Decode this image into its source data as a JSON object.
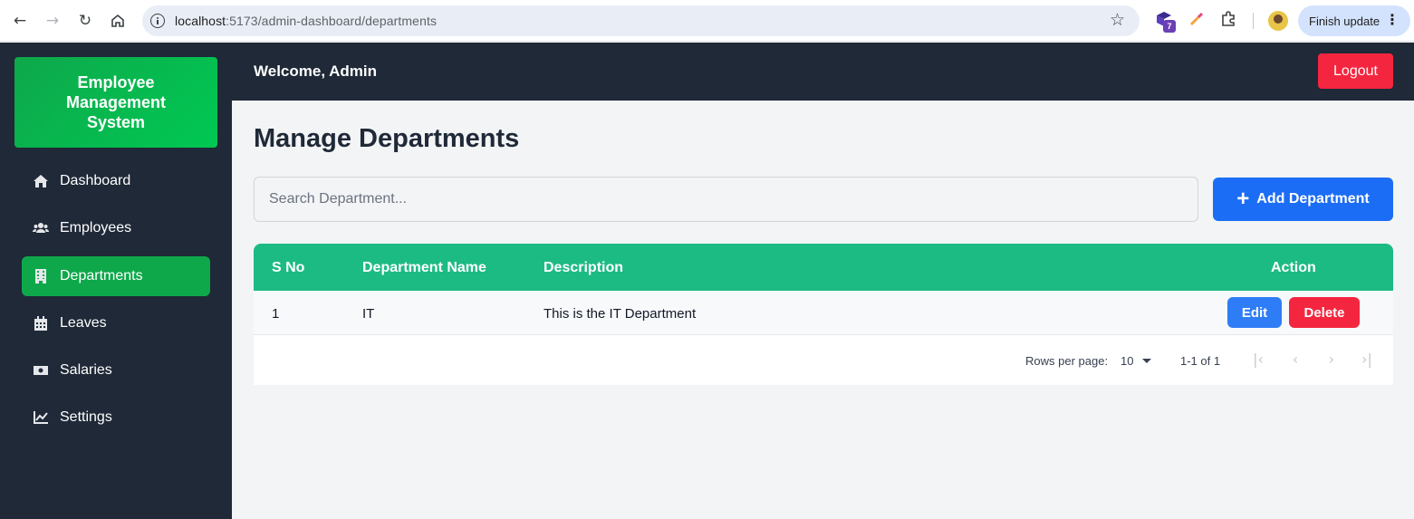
{
  "browser": {
    "url_host": "localhost",
    "url_rest": ":5173/admin-dashboard/departments",
    "extension_badge": "7",
    "finish_update": "Finish update"
  },
  "sidebar": {
    "brand": "Employee Management System",
    "items": [
      {
        "label": "Dashboard",
        "icon": "home-icon",
        "active": false
      },
      {
        "label": "Employees",
        "icon": "users-icon",
        "active": false
      },
      {
        "label": "Departments",
        "icon": "building-icon",
        "active": true
      },
      {
        "label": "Leaves",
        "icon": "calendar-icon",
        "active": false
      },
      {
        "label": "Salaries",
        "icon": "money-icon",
        "active": false
      },
      {
        "label": "Settings",
        "icon": "chart-icon",
        "active": false
      }
    ]
  },
  "topbar": {
    "welcome": "Welcome, Admin",
    "logout": "Logout"
  },
  "main": {
    "title": "Manage Departments",
    "search_placeholder": "Search Department...",
    "add_button": "Add Department",
    "table": {
      "columns": [
        "S No",
        "Department Name",
        "Description",
        "Action"
      ],
      "rows": [
        {
          "sno": "1",
          "name": "IT",
          "description": "This is the IT Department",
          "edit": "Edit",
          "delete": "Delete"
        }
      ]
    },
    "pagination": {
      "rows_per_page_label": "Rows per page:",
      "rows_per_page": "10",
      "range": "1-1 of 1"
    }
  },
  "colors": {
    "sidebar_bg": "#1f2937",
    "accent_green": "#0ea84b",
    "table_header": "#1dbb84",
    "primary_blue": "#1c6df5",
    "danger_red": "#f4263f"
  }
}
